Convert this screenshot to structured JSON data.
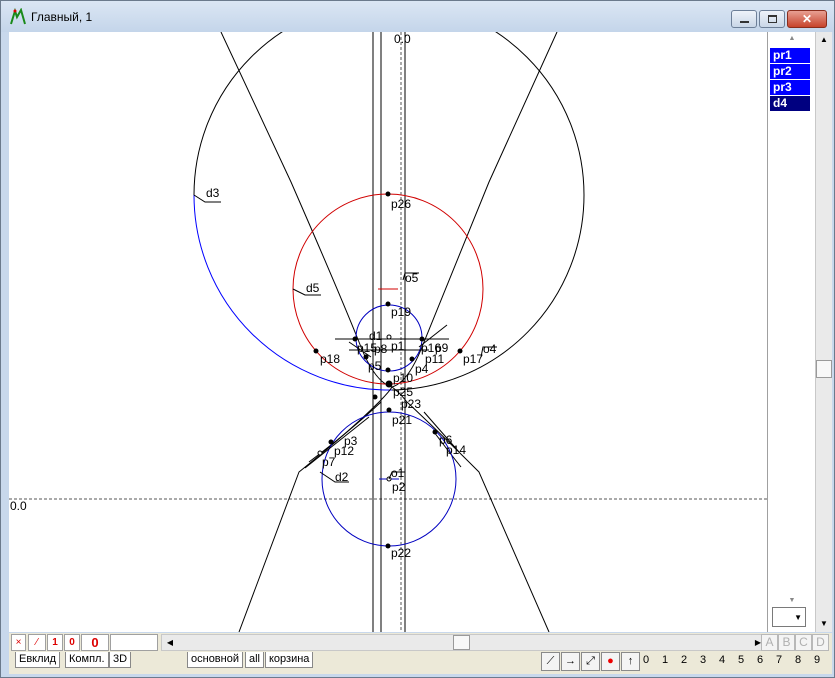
{
  "window": {
    "title": "Главный, 1",
    "controls": [
      "minimize",
      "maximize",
      "close"
    ]
  },
  "canvas": {
    "origin_x_label": "0.0",
    "origin_y_label": "0.0",
    "labels": [
      "d3",
      "p26",
      "o5",
      "d5",
      "p19",
      "d1",
      "p1",
      "p16",
      "p15",
      "p8",
      "p9",
      "p18",
      "p17",
      "o4",
      "p11",
      "p5",
      "p4",
      "p10",
      "p25",
      "p23",
      "p21",
      "p3",
      "p12",
      "p7",
      "p6",
      "p14",
      "d2",
      "o1",
      "p2",
      "p22"
    ]
  },
  "layers_panel": {
    "items": [
      "pr1",
      "pr2",
      "pr3",
      "d4"
    ],
    "selected": "d4",
    "colors": {
      "item": "#0000ff",
      "selected": "#000080"
    }
  },
  "status_row": {
    "buttons": [
      "×",
      "⁄",
      "1",
      "0"
    ],
    "counter": "0",
    "letters": [
      "A",
      "B",
      "C",
      "D"
    ]
  },
  "tabs": {
    "left": [
      "Евклид",
      "Компл.",
      "3D"
    ],
    "right": [
      "основной",
      "all",
      "корзина"
    ],
    "active": "основной"
  },
  "toolbar": {
    "tool_icons": [
      "line-tool-icon",
      "arrow-right-icon",
      "diagonal-arrow-icon",
      "red-dot-icon",
      "up-arrow-icon"
    ],
    "numbers": [
      "0",
      "1",
      "2",
      "3",
      "4",
      "5",
      "6",
      "7",
      "8",
      "9"
    ]
  }
}
